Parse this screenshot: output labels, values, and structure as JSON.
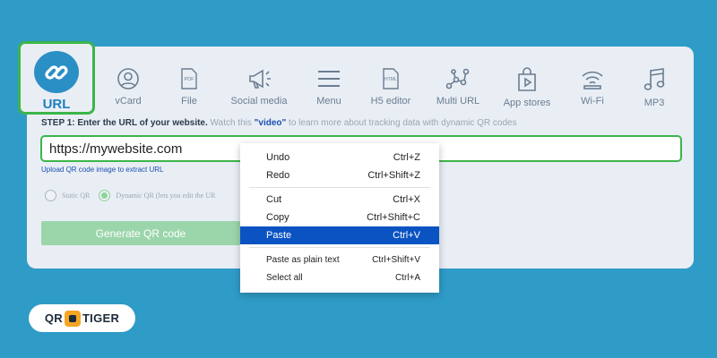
{
  "tabs": {
    "url": {
      "label": "URL",
      "icon": "link-icon"
    },
    "items": [
      {
        "label": "vCard",
        "icon": "user-icon"
      },
      {
        "label": "File",
        "icon": "pdf-file-icon"
      },
      {
        "label": "Social media",
        "icon": "megaphone-icon"
      },
      {
        "label": "Menu",
        "icon": "menu-icon"
      },
      {
        "label": "H5 editor",
        "icon": "html-file-icon"
      },
      {
        "label": "Multi URL",
        "icon": "network-icon"
      },
      {
        "label": "App stores",
        "icon": "shopping-bag-icon"
      },
      {
        "label": "Wi-Fi",
        "icon": "wifi-icon"
      },
      {
        "label": "MP3",
        "icon": "music-note-icon"
      }
    ]
  },
  "step": {
    "title": "STEP 1: Enter the URL of your website.",
    "hint_before": " Watch this ",
    "video_link": "\"video\"",
    "hint_after": " to learn more about tracking data with dynamic QR codes"
  },
  "url_input": {
    "value": "https://mywebsite.com"
  },
  "upload_link": "Upload QR code image to extract URL",
  "qr_type": {
    "static": "Static QR",
    "dynamic": "Dynamic QR (lets you edit the UR",
    "selected": "dynamic"
  },
  "generate_button": "Generate QR code",
  "context_menu": {
    "items": [
      {
        "label": "Undo",
        "shortcut": "Ctrl+Z"
      },
      {
        "label": "Redo",
        "shortcut": "Ctrl+Shift+Z"
      },
      {
        "label": "Cut",
        "shortcut": "Ctrl+X"
      },
      {
        "label": "Copy",
        "shortcut": "Ctrl+Shift+C"
      },
      {
        "label": "Paste",
        "shortcut": "Ctrl+V",
        "highlighted": true
      },
      {
        "label": "Paste as plain text",
        "shortcut": "Ctrl+Shift+V"
      },
      {
        "label": "Select all",
        "shortcut": "Ctrl+A"
      }
    ]
  },
  "logo": {
    "left": "QR",
    "right": "TIGER"
  },
  "colors": {
    "background": "#2f9bc7",
    "accent_green": "#3cb54a",
    "link_blue": "#1a4fb0",
    "menu_highlight": "#0b53c2"
  }
}
